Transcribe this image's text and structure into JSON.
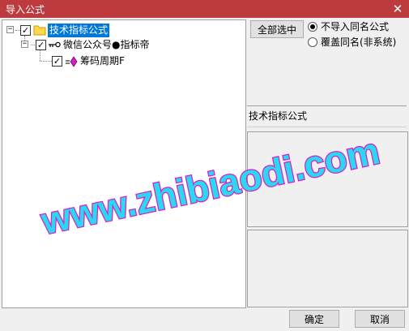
{
  "window": {
    "title": "导入公式",
    "close_glyph": "✕"
  },
  "tree": {
    "nodes": [
      {
        "label": "技术指标公式",
        "expander": "−",
        "checked": "✓",
        "selected": true,
        "icon": "folder-icon"
      },
      {
        "label": "微信公众号●指标帝",
        "expander": "−",
        "checked": "✓",
        "selected": false,
        "icon": "key-icon"
      },
      {
        "label": "筹码周期F",
        "checked": "✓",
        "selected": false,
        "icon": "diamond-icon"
      }
    ]
  },
  "controls": {
    "select_all_label": "全部选中",
    "radio_options": [
      {
        "label": "不导入同名公式",
        "checked": true
      },
      {
        "label": "覆盖同名(非系统)",
        "checked": false
      }
    ]
  },
  "info": {
    "formula_name": "技术指标公式"
  },
  "footer": {
    "ok_label": "确定",
    "cancel_label": "取消"
  },
  "watermark": {
    "text": "www.zhibiaodi.com"
  },
  "colors": {
    "titlebar": "#bd3b3e",
    "selection": "#0078d7",
    "watermark_fill": "#2ad9f0",
    "watermark_outline": "#d81ec8"
  }
}
